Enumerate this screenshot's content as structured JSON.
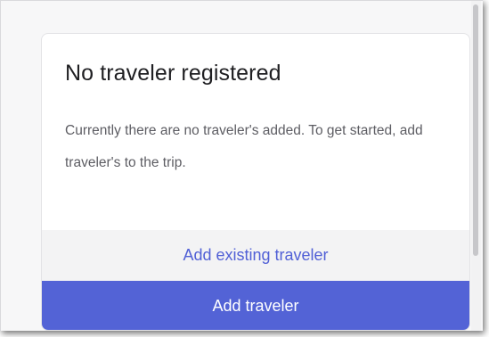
{
  "card": {
    "title": "No traveler registered",
    "description": "Currently there are no traveler's added. To get started, add traveler's to the trip.",
    "secondary_action_label": "Add existing traveler",
    "primary_action_label": "Add traveler"
  },
  "colors": {
    "accent": "#5363d6",
    "link_text": "#5160d6",
    "secondary_background": "#f3f3f4",
    "title_text": "#1f1f22",
    "body_text": "#5d5d63"
  }
}
